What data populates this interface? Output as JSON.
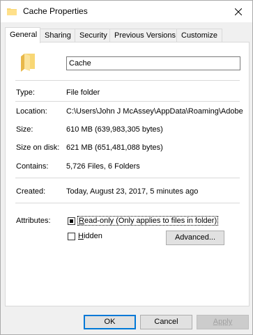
{
  "window": {
    "title": "Cache Properties"
  },
  "tabs": [
    {
      "label": "General",
      "active": true
    },
    {
      "label": "Sharing"
    },
    {
      "label": "Security"
    },
    {
      "label": "Previous Versions"
    },
    {
      "label": "Customize"
    }
  ],
  "general": {
    "name": "Cache",
    "type_label": "Type:",
    "type_value": "File folder",
    "location_label": "Location:",
    "location_value": "C:\\Users\\John J McAssey\\AppData\\Roaming\\Adobe",
    "size_label": "Size:",
    "size_value": "610 MB (639,983,305 bytes)",
    "sizeondisk_label": "Size on disk:",
    "sizeondisk_value": "621 MB (651,481,088 bytes)",
    "contains_label": "Contains:",
    "contains_value": "5,726 Files, 6 Folders",
    "created_label": "Created:",
    "created_value": "Today, August 23, 2017, 5 minutes ago",
    "attributes_label": "Attributes:",
    "readonly_rest": "ead-only (Only applies to files in folder)",
    "readonly_state": "indeterminate",
    "hidden_rest": "idden",
    "hidden_state": "unchecked",
    "advanced_label": "Advanced..."
  },
  "buttons": {
    "ok": "OK",
    "cancel": "Cancel",
    "apply": "Apply"
  },
  "colors": {
    "folder": "#f8d775",
    "folder_dark": "#e8b84a",
    "accent": "#0078d7"
  }
}
